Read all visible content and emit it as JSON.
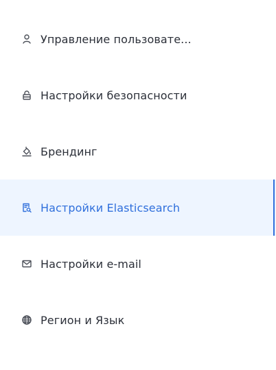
{
  "sidebar": {
    "items": [
      {
        "label": "Управление пользовате...",
        "icon": "user-icon"
      },
      {
        "label": "Настройки безопасности",
        "icon": "lock-icon"
      },
      {
        "label": "Брендинг",
        "icon": "paint-bucket-icon"
      },
      {
        "label": "Настройки Elasticsearch",
        "icon": "search-document-icon",
        "active": true
      },
      {
        "label": "Настройки e-mail",
        "icon": "mail-icon"
      },
      {
        "label": "Регион и Язык",
        "icon": "globe-icon"
      }
    ]
  },
  "colors": {
    "active_background": "#eef5ff",
    "active_text": "#2f6fdc",
    "text": "#2b2f38",
    "icon": "#4b4f58"
  }
}
